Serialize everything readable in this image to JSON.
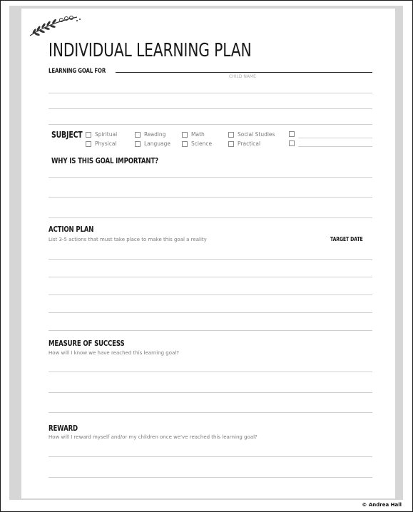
{
  "title": "INDIVIDUAL LEARNING PLAN",
  "goal_for_label": "LEARNING GOAL FOR",
  "child_name_caption": "CHILD NAME",
  "subject": {
    "label": "SUBJECT",
    "options_row1": [
      "Spiritual",
      "Reading",
      "Math",
      "Social Studies",
      ""
    ],
    "options_row2": [
      "Physical",
      "Language",
      "Science",
      "Practical",
      ""
    ]
  },
  "why_heading": "WHY IS THIS GOAL IMPORTANT?",
  "action_plan": {
    "heading": "ACTION PLAN",
    "instruction": "List 3-5 actions that must take place to make this goal a reality",
    "target_date_label": "TARGET DATE"
  },
  "measure": {
    "heading": "MEASURE OF SUCCESS",
    "question": "How will I know we have reached this learning goal?"
  },
  "reward": {
    "heading": "REWARD",
    "question": "How will I reward myself and/or my children once we've reached this learning goal?"
  },
  "credit": "© Andrea Hall"
}
